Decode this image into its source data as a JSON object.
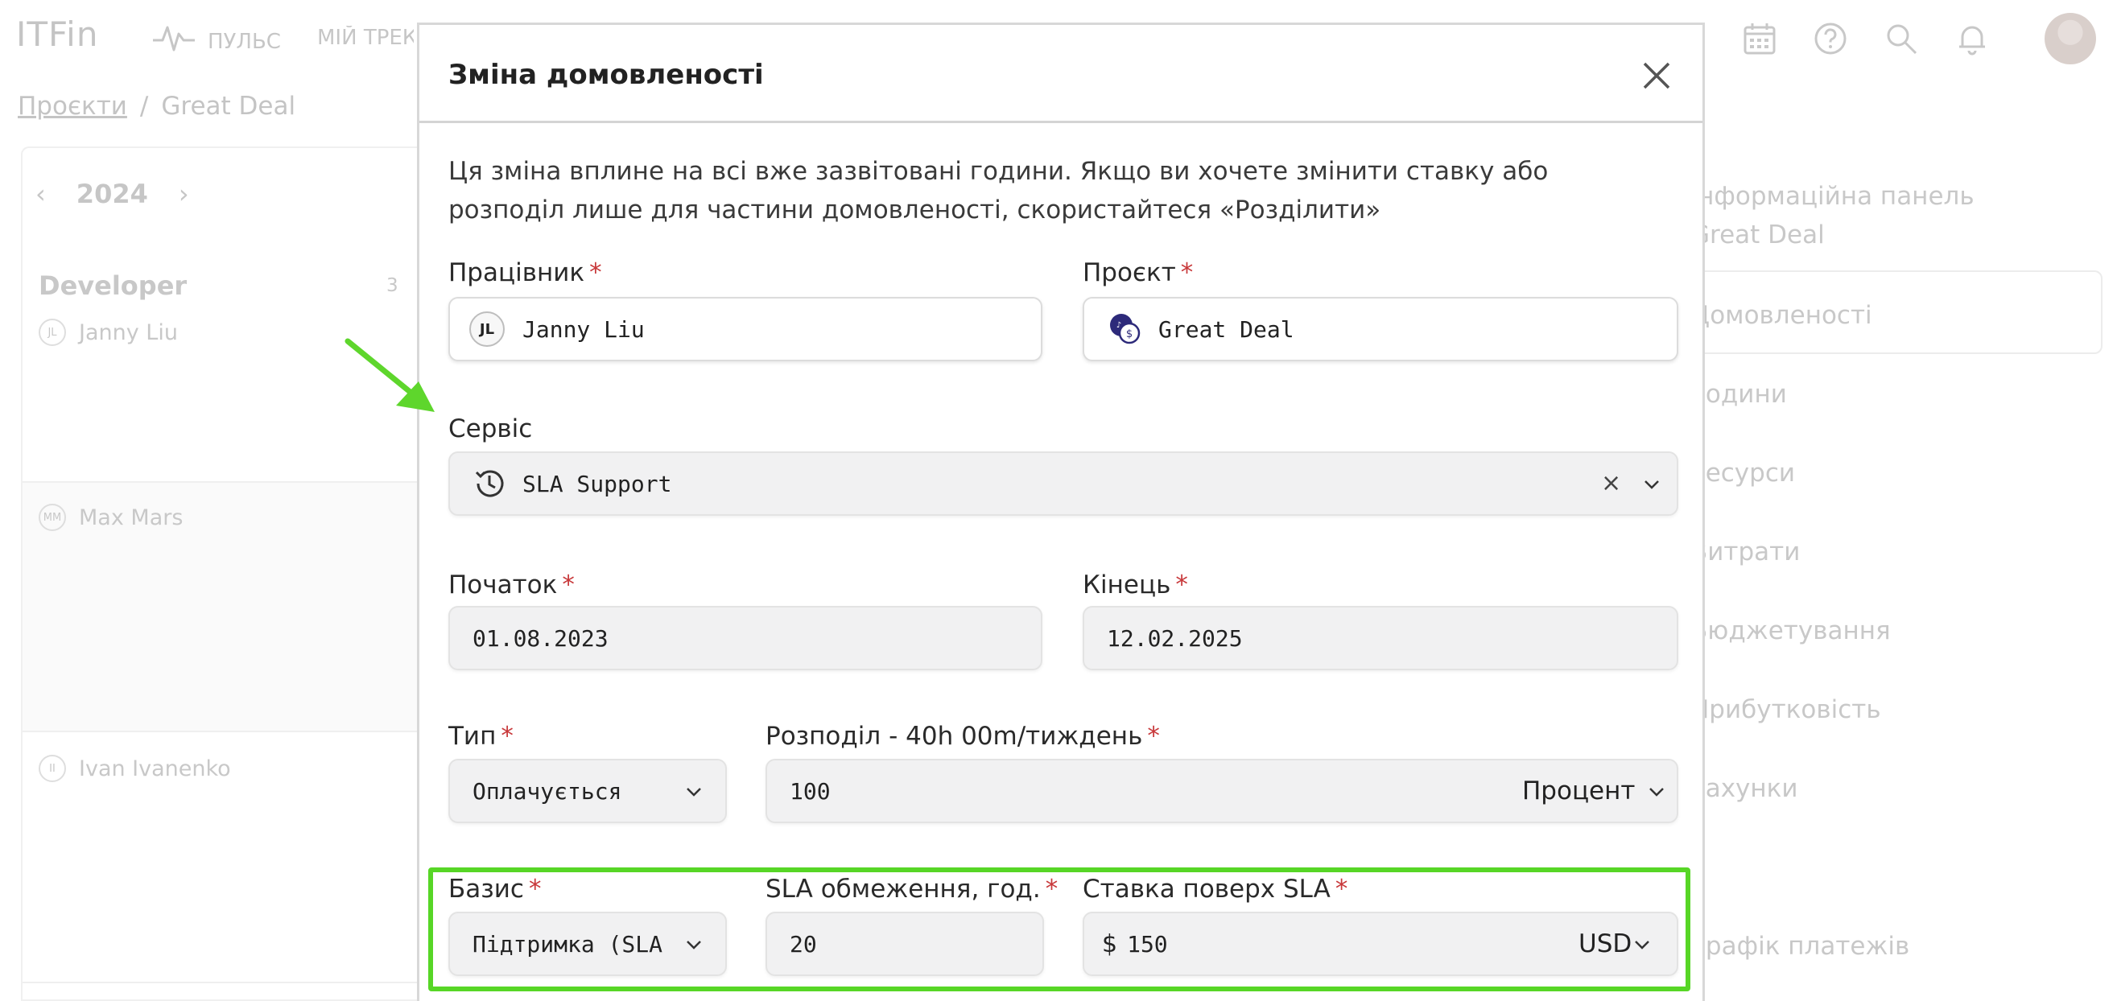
{
  "app": {
    "logo": "ITFin",
    "nav": {
      "pulse": "ПУЛЬС",
      "tracker": "МІЙ ТРЕКЕР"
    }
  },
  "breadcrumb": {
    "projects": "Проєкти",
    "separator": "/",
    "current": "Great Deal"
  },
  "left_panel": {
    "year": "2024",
    "role": "Developer",
    "role_count": "3",
    "people": [
      {
        "initials": "JL",
        "name": "Janny Liu"
      },
      {
        "initials": "MM",
        "name": "Max Mars"
      },
      {
        "initials": "II",
        "name": "Ivan Ivanenko"
      }
    ]
  },
  "right_menu": [
    "Інформаційна панель",
    "Great Deal",
    "Домовленості",
    "Години",
    "Ресурси",
    "Витрати",
    "Бюджетування",
    "Прибутковість",
    "Рахунки",
    "Графік платежів"
  ],
  "modal": {
    "title": "Зміна домовленості",
    "notice": "Ця зміна вплине на всі вже зазвітовані години. Якщо ви хочете змінити ставку або розподіл лише для частини домовленості, скористайтеся «Розділити»",
    "employee": {
      "label": "Працівник",
      "initials": "JL",
      "value": "Janny Liu"
    },
    "project": {
      "label": "Проєкт",
      "value": "Great Deal"
    },
    "service": {
      "label": "Сервіс",
      "value": "SLA Support",
      "clear": "×"
    },
    "start": {
      "label": "Початок",
      "value": "01.08.2023"
    },
    "end": {
      "label": "Кінець",
      "value": "12.02.2025"
    },
    "type": {
      "label": "Тип",
      "value": "Оплачується"
    },
    "allocation": {
      "label": "Розподіл - 40h 00m/тиждень",
      "value": "100",
      "unit": "Процент"
    },
    "basis": {
      "label": "Базис",
      "value": "Підтримка (SLA"
    },
    "sla_limit": {
      "label": "SLA обмеження, год.",
      "value": "20"
    },
    "rate": {
      "label": "Ставка поверх SLA",
      "currency_symbol": "$",
      "value": "150",
      "currency": "USD"
    },
    "required_mark": "*"
  },
  "colors": {
    "highlight": "#57d626",
    "required": "#c8383a"
  }
}
